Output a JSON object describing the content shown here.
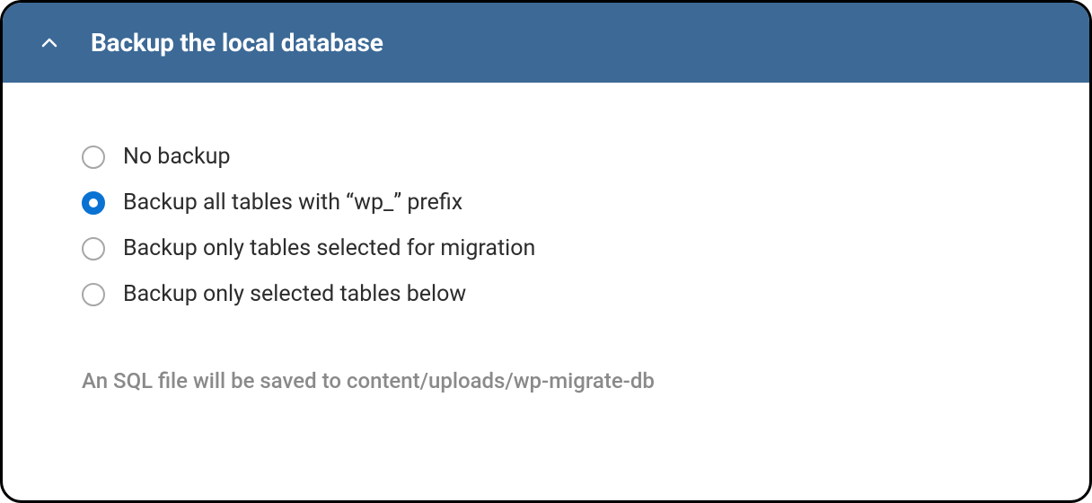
{
  "header": {
    "title": "Backup the local database"
  },
  "options": [
    {
      "label": "No backup",
      "selected": false
    },
    {
      "label": "Backup all tables with “wp_” prefix",
      "selected": true
    },
    {
      "label": "Backup only tables selected for migration",
      "selected": false
    },
    {
      "label": "Backup only selected tables below",
      "selected": false
    }
  ],
  "note": "An SQL file will be saved to content/uploads/wp-migrate-db"
}
